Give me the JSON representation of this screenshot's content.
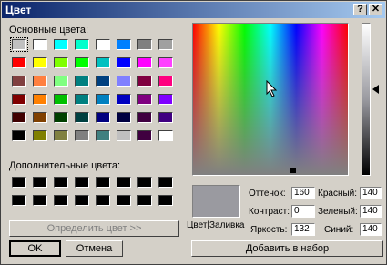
{
  "window": {
    "title": "Цвет",
    "help_label": "?",
    "close_label": "✕"
  },
  "basic": {
    "label": "Основные цвета:",
    "colors": [
      [
        "#c0c0c0",
        "#ffffff",
        "#00ffff",
        "#00ffcc",
        "#ffffff",
        "#0080ff",
        "#808080",
        "#a0a0a0"
      ],
      [
        "#ff0000",
        "#ffff00",
        "#80ff00",
        "#00ff00",
        "#00c0c0",
        "#0000ff",
        "#ff00ff",
        "#ff40ff"
      ],
      [
        "#804040",
        "#ff8040",
        "#80ff80",
        "#008080",
        "#004080",
        "#8080ff",
        "#800040",
        "#ff0080"
      ],
      [
        "#800000",
        "#ff8000",
        "#00c000",
        "#008080",
        "#0080c0",
        "#0000c0",
        "#800080",
        "#8000ff"
      ],
      [
        "#400000",
        "#804000",
        "#004000",
        "#004040",
        "#000080",
        "#000040",
        "#400040",
        "#400080"
      ],
      [
        "#000000",
        "#808000",
        "#808040",
        "#808080",
        "#408080",
        "#c0c0c0",
        "#400040",
        "#ffffff"
      ]
    ]
  },
  "custom": {
    "label": "Дополнительные цвета:",
    "colors": [
      [
        "#000000",
        "#000000",
        "#000000",
        "#000000",
        "#000000",
        "#000000",
        "#000000",
        "#000000"
      ],
      [
        "#000000",
        "#000000",
        "#000000",
        "#000000",
        "#000000",
        "#000000",
        "#000000",
        "#000000"
      ]
    ]
  },
  "buttons": {
    "define_custom": "Определить цвет >>",
    "ok": "OK",
    "cancel": "Отмена",
    "add_custom": "Добавить в набор"
  },
  "preview": {
    "label": "Цвет|Заливка",
    "color": "#9a9aa0"
  },
  "hsl": [
    {
      "label": "Оттенок:",
      "value": "160"
    },
    {
      "label": "Контраст:",
      "value": "0"
    },
    {
      "label": "Яркость:",
      "value": "132"
    }
  ],
  "rgb": [
    {
      "label": "Красный:",
      "value": "140"
    },
    {
      "label": "Зеленый:",
      "value": "140"
    },
    {
      "label": "Синий:",
      "value": "140"
    }
  ]
}
